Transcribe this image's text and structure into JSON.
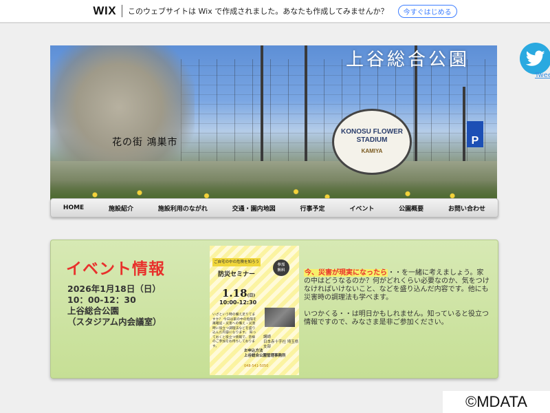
{
  "wix_banner": {
    "logo": "WIX",
    "message": "このウェブサイトは Wix で作成されました。あなたも作成してみませんか？",
    "cta": "今すぐはじめる"
  },
  "hero": {
    "park_title": "上谷総合公園",
    "tagline": "花の街 鴻巣市",
    "stadium_sign_line1": "KONOSU FLOWER",
    "stadium_sign_line2": "STADIUM",
    "stadium_sign_sponsor": "KAMIYA",
    "parking_letter": "P"
  },
  "nav": {
    "items": [
      {
        "label": "HOME"
      },
      {
        "label": "施設紹介"
      },
      {
        "label": "施設利用のながれ"
      },
      {
        "label": "交通・園内地図"
      },
      {
        "label": "行事予定"
      },
      {
        "label": "イベント"
      },
      {
        "label": "公園概要"
      },
      {
        "label": "お問い合わせ"
      }
    ]
  },
  "event": {
    "heading": "イベント情報",
    "date": "2026年1月18日（日）",
    "time": "10：00-12：30",
    "venue": "上谷総合公園",
    "room": "（スタジアム内会議室）",
    "flyer": {
      "banner": "ご自宅の中の危険を知ろう",
      "title": "防災セミナー",
      "badge_line1": "参加",
      "badge_line2": "無料",
      "date": "1.18",
      "day": "(日)",
      "time": "10:00-12:30",
      "body": "いざという時の備え足りてますか？ 今日は家の中の危険を再確認・災害への備え・災害時に役立つ調理法などを盛り込んだ内容になります。 知っておくと役立つ情報で、皆様のご参加をお待ちしております。",
      "lecturer_label": "講師",
      "lecturer": "日本赤十字社 埼玉県支部",
      "apply_label": "お申込方法",
      "apply_text": "上谷総合公園管理事務所",
      "phone": "048-541-5050"
    },
    "desc_highlight": "今、災害が現実になったら",
    "desc_p1_rest": "・・を一緒に考えましょう。家の中はどうなるのか？何がどれくらい必要なのか、気をつけなければいけないこと、などを盛り込んだ内容です。他にも災害時の調理法も学べます。",
    "desc_p2": "いつかくる・・は明日かもしれません。知っていると役立つ情報ですので、みなさま是非ご参加ください。"
  },
  "twitter": {
    "label": "Tweet"
  },
  "copyright": "©MDATA",
  "colors": {
    "accent_red": "#e8312c",
    "card_green": "#c6df95",
    "twitter_blue": "#2aa9e0",
    "wix_cta_blue": "#3b7cff"
  }
}
